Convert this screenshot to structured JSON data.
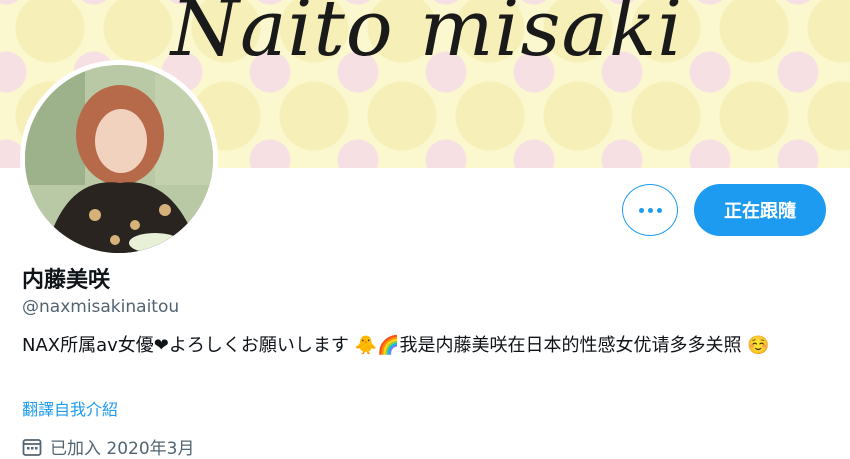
{
  "banner": {
    "title": "Naito misaki"
  },
  "profile": {
    "display_name": "内藤美咲",
    "handle": "@naxmisakinaitou",
    "bio_part1": "NAX所属av女優",
    "heart": "❤",
    "bio_part2": "よろしくお願いします",
    "chick": "🐥",
    "rainbow": "🌈",
    "bio_part3": "我是内藤美咲在日本的性感女优请多多关照",
    "smile": "☺️",
    "translate_label": "翻譯自我介紹",
    "joined_label": "已加入 2020年3月"
  },
  "actions": {
    "more_label": "更多",
    "following_label": "正在跟隨"
  },
  "colors": {
    "accent": "#1d9bf0",
    "secondary_text": "#536471",
    "banner_yellow": "#fbf8cf",
    "banner_pink": "#f6dde6"
  },
  "icons": {
    "more": "three-dots-icon",
    "joined": "calendar-icon"
  }
}
